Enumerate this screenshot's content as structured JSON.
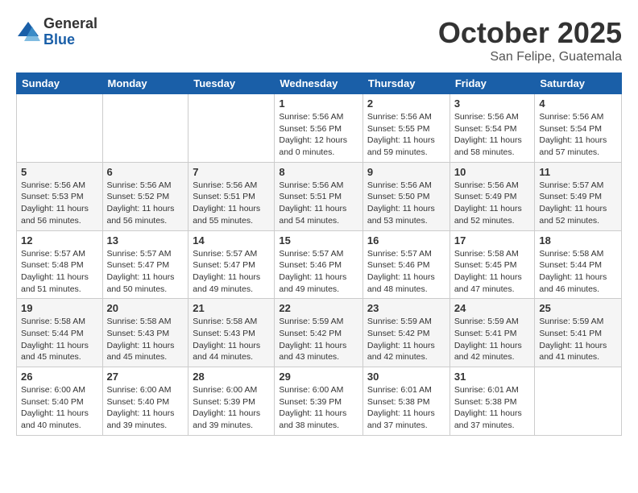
{
  "logo": {
    "general": "General",
    "blue": "Blue"
  },
  "title": "October 2025",
  "location": "San Felipe, Guatemala",
  "days_of_week": [
    "Sunday",
    "Monday",
    "Tuesday",
    "Wednesday",
    "Thursday",
    "Friday",
    "Saturday"
  ],
  "weeks": [
    [
      {
        "day": "",
        "info": ""
      },
      {
        "day": "",
        "info": ""
      },
      {
        "day": "",
        "info": ""
      },
      {
        "day": "1",
        "info": "Sunrise: 5:56 AM\nSunset: 5:56 PM\nDaylight: 12 hours and 0 minutes."
      },
      {
        "day": "2",
        "info": "Sunrise: 5:56 AM\nSunset: 5:55 PM\nDaylight: 11 hours and 59 minutes."
      },
      {
        "day": "3",
        "info": "Sunrise: 5:56 AM\nSunset: 5:54 PM\nDaylight: 11 hours and 58 minutes."
      },
      {
        "day": "4",
        "info": "Sunrise: 5:56 AM\nSunset: 5:54 PM\nDaylight: 11 hours and 57 minutes."
      }
    ],
    [
      {
        "day": "5",
        "info": "Sunrise: 5:56 AM\nSunset: 5:53 PM\nDaylight: 11 hours and 56 minutes."
      },
      {
        "day": "6",
        "info": "Sunrise: 5:56 AM\nSunset: 5:52 PM\nDaylight: 11 hours and 56 minutes."
      },
      {
        "day": "7",
        "info": "Sunrise: 5:56 AM\nSunset: 5:51 PM\nDaylight: 11 hours and 55 minutes."
      },
      {
        "day": "8",
        "info": "Sunrise: 5:56 AM\nSunset: 5:51 PM\nDaylight: 11 hours and 54 minutes."
      },
      {
        "day": "9",
        "info": "Sunrise: 5:56 AM\nSunset: 5:50 PM\nDaylight: 11 hours and 53 minutes."
      },
      {
        "day": "10",
        "info": "Sunrise: 5:56 AM\nSunset: 5:49 PM\nDaylight: 11 hours and 52 minutes."
      },
      {
        "day": "11",
        "info": "Sunrise: 5:57 AM\nSunset: 5:49 PM\nDaylight: 11 hours and 52 minutes."
      }
    ],
    [
      {
        "day": "12",
        "info": "Sunrise: 5:57 AM\nSunset: 5:48 PM\nDaylight: 11 hours and 51 minutes."
      },
      {
        "day": "13",
        "info": "Sunrise: 5:57 AM\nSunset: 5:47 PM\nDaylight: 11 hours and 50 minutes."
      },
      {
        "day": "14",
        "info": "Sunrise: 5:57 AM\nSunset: 5:47 PM\nDaylight: 11 hours and 49 minutes."
      },
      {
        "day": "15",
        "info": "Sunrise: 5:57 AM\nSunset: 5:46 PM\nDaylight: 11 hours and 49 minutes."
      },
      {
        "day": "16",
        "info": "Sunrise: 5:57 AM\nSunset: 5:46 PM\nDaylight: 11 hours and 48 minutes."
      },
      {
        "day": "17",
        "info": "Sunrise: 5:58 AM\nSunset: 5:45 PM\nDaylight: 11 hours and 47 minutes."
      },
      {
        "day": "18",
        "info": "Sunrise: 5:58 AM\nSunset: 5:44 PM\nDaylight: 11 hours and 46 minutes."
      }
    ],
    [
      {
        "day": "19",
        "info": "Sunrise: 5:58 AM\nSunset: 5:44 PM\nDaylight: 11 hours and 45 minutes."
      },
      {
        "day": "20",
        "info": "Sunrise: 5:58 AM\nSunset: 5:43 PM\nDaylight: 11 hours and 45 minutes."
      },
      {
        "day": "21",
        "info": "Sunrise: 5:58 AM\nSunset: 5:43 PM\nDaylight: 11 hours and 44 minutes."
      },
      {
        "day": "22",
        "info": "Sunrise: 5:59 AM\nSunset: 5:42 PM\nDaylight: 11 hours and 43 minutes."
      },
      {
        "day": "23",
        "info": "Sunrise: 5:59 AM\nSunset: 5:42 PM\nDaylight: 11 hours and 42 minutes."
      },
      {
        "day": "24",
        "info": "Sunrise: 5:59 AM\nSunset: 5:41 PM\nDaylight: 11 hours and 42 minutes."
      },
      {
        "day": "25",
        "info": "Sunrise: 5:59 AM\nSunset: 5:41 PM\nDaylight: 11 hours and 41 minutes."
      }
    ],
    [
      {
        "day": "26",
        "info": "Sunrise: 6:00 AM\nSunset: 5:40 PM\nDaylight: 11 hours and 40 minutes."
      },
      {
        "day": "27",
        "info": "Sunrise: 6:00 AM\nSunset: 5:40 PM\nDaylight: 11 hours and 39 minutes."
      },
      {
        "day": "28",
        "info": "Sunrise: 6:00 AM\nSunset: 5:39 PM\nDaylight: 11 hours and 39 minutes."
      },
      {
        "day": "29",
        "info": "Sunrise: 6:00 AM\nSunset: 5:39 PM\nDaylight: 11 hours and 38 minutes."
      },
      {
        "day": "30",
        "info": "Sunrise: 6:01 AM\nSunset: 5:38 PM\nDaylight: 11 hours and 37 minutes."
      },
      {
        "day": "31",
        "info": "Sunrise: 6:01 AM\nSunset: 5:38 PM\nDaylight: 11 hours and 37 minutes."
      },
      {
        "day": "",
        "info": ""
      }
    ]
  ]
}
